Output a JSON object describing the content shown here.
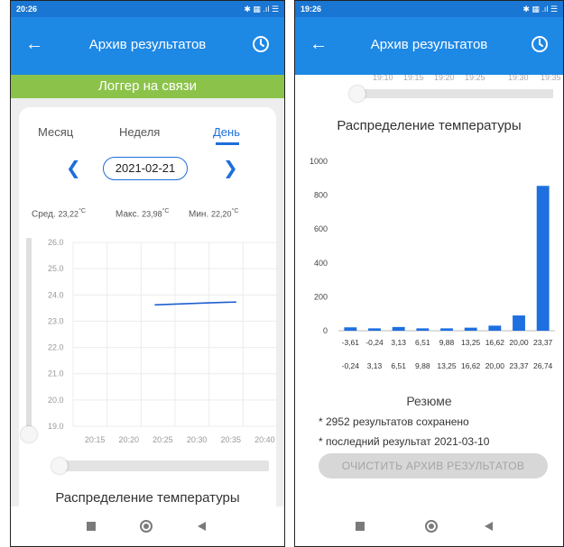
{
  "left": {
    "status": {
      "time": "20:26",
      "icons": "✱ ▦ .ıl ☰"
    },
    "appbar": {
      "title": "Архив результатов"
    },
    "connection_banner": "Логгер на связи",
    "tabs": [
      {
        "label": "Месяц",
        "active": false
      },
      {
        "label": "Неделя",
        "active": false
      },
      {
        "label": "День",
        "active": true
      }
    ],
    "date": "2021-02-21",
    "stats": {
      "avg_label": "Сред.",
      "avg_value": "23,22",
      "max_label": "Макс.",
      "max_value": "23,98",
      "min_label": "Мин.",
      "min_value": "22,20",
      "unit": "°C"
    },
    "section_title": "Распределение температуры"
  },
  "right": {
    "status": {
      "time": "19:26",
      "icons": "✱ ▦ .ıl ☰"
    },
    "appbar": {
      "title": "Архив результатов"
    },
    "top_ticks": [
      "19:10",
      "19:15",
      "19:20",
      "19:25",
      "19:30",
      "19:35"
    ],
    "section_title": "Распределение температуры",
    "resume_title": "Резюме",
    "saved_line": "* 2952 результатов сохранено",
    "last_line": "* последний результат 2021-03-10",
    "clear_button": "ОЧИСТИТЬ АРХИВ РЕЗУЛЬТАТОВ"
  },
  "colors": {
    "appbar": "#1e88e5",
    "statusbar": "#1976d2",
    "banner": "#8bc34a",
    "accent": "#1e6fd9",
    "line": "#1e5fd0",
    "bar": "#1e6fe0"
  },
  "chart_data": [
    {
      "type": "line",
      "x": [
        "20:15",
        "20:20",
        "20:25",
        "20:30",
        "20:35",
        "20:40"
      ],
      "ylim": [
        19.0,
        26.0
      ],
      "yticks": [
        "19.0",
        "20.0",
        "21.0",
        "22.0",
        "23.0",
        "24.0",
        "25.0",
        "26.0"
      ],
      "series": [
        {
          "x_minutes": [
            12,
            16,
            20,
            24
          ],
          "y": [
            23.62,
            23.66,
            23.7,
            23.73
          ]
        }
      ]
    },
    {
      "type": "bar",
      "yticks": [
        "0",
        "200",
        "400",
        "600",
        "800",
        "1000"
      ],
      "ylim": [
        0,
        1000
      ],
      "bins_from": [
        "-3,61",
        "-0,24",
        "3,13",
        "6,51",
        "9,88",
        "13,25",
        "16,62",
        "20,00",
        "23,37"
      ],
      "bins_to": [
        "-0,24",
        "3,13",
        "6,51",
        "9,88",
        "13,25",
        "16,62",
        "20,00",
        "23,37",
        "26,74"
      ],
      "values": [
        20,
        14,
        22,
        14,
        14,
        18,
        30,
        90,
        855
      ]
    }
  ]
}
